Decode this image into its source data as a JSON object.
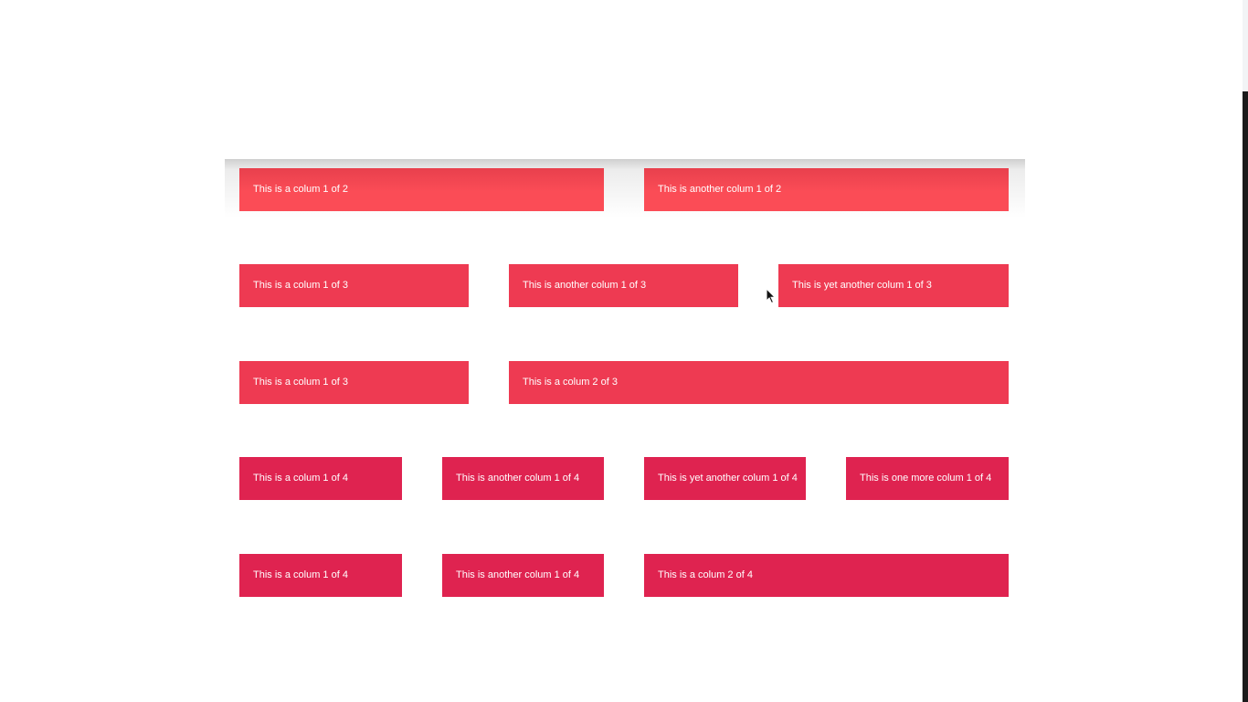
{
  "rows": [
    {
      "cols": [
        "This is a colum 1 of 2",
        "This is another colum 1 of 2"
      ]
    },
    {
      "cols": [
        "This is a colum 1 of 3",
        "This is another colum 1 of 3",
        "This is yet another colum 1 of 3"
      ]
    },
    {
      "cols": [
        "This is a colum 1 of 3",
        "This is a colum 2 of 3"
      ]
    },
    {
      "cols": [
        "This is a colum 1 of 4",
        "This is another colum 1 of 4",
        "This is yet another colum 1 of 4",
        "This is one more colum 1 of 4"
      ]
    },
    {
      "cols": [
        "This is a colum 1 of 4",
        "This is another colum 1 of 4",
        "This is a colum 2 of 4"
      ]
    }
  ],
  "colors": {
    "row1": "#fb4c56",
    "row2": "#ee3a52",
    "row3": "#ee3a52",
    "row4": "#df2350",
    "row5": "#df2350",
    "text": "#ffffff",
    "background": "#ffffff"
  },
  "cursor_icon": "arrow-cursor-icon"
}
